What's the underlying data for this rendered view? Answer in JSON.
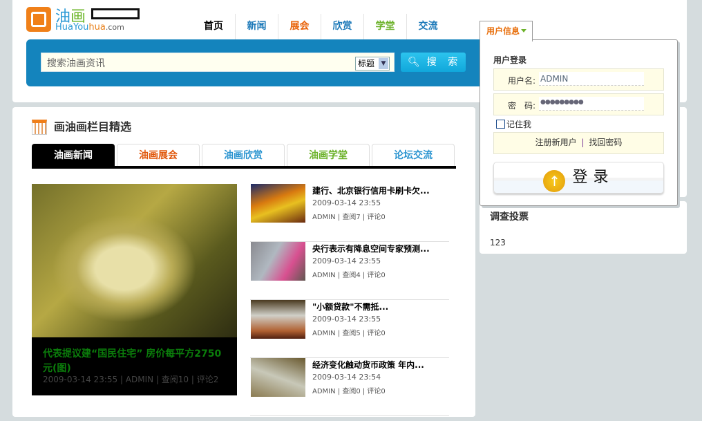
{
  "logo": {
    "cn1": "油",
    "cn2": "画",
    "en1": "HuaYou",
    "en2": "hua",
    "en3": ".com"
  },
  "nav": [
    {
      "label": "首页",
      "color": "#000000"
    },
    {
      "label": "新闻",
      "color": "#1a78b8"
    },
    {
      "label": "展会",
      "color": "#e8640c"
    },
    {
      "label": "欣赏",
      "color": "#1a78b8"
    },
    {
      "label": "学堂",
      "color": "#6cb22a"
    },
    {
      "label": "交流",
      "color": "#1a78b8"
    }
  ],
  "search": {
    "placeholder": "搜索油画资讯",
    "select_value": "标题",
    "button": "搜 索"
  },
  "section": {
    "title": "画油画栏目精选"
  },
  "tabs": [
    {
      "label": "油画新闻",
      "color": "#ffffff"
    },
    {
      "label": "油画展会",
      "color": "#e0560a"
    },
    {
      "label": "油画欣赏",
      "color": "#2a94d0"
    },
    {
      "label": "油画学堂",
      "color": "#6cb22a"
    },
    {
      "label": "论坛交流",
      "color": "#2a94d0"
    }
  ],
  "feature": {
    "title": "代表提议建“国民住宅” 房价每平方2750元(图)",
    "meta": "2009-03-14 23:55 | ADMIN | 查阅10 | 评论2"
  },
  "news": [
    {
      "title": "建行、北京银行信用卡刷卡欠...",
      "date": "2009-03-14 23:55",
      "meta": "ADMIN | 查阅7 | 评论0"
    },
    {
      "title": "央行表示有降息空间专家预测...",
      "date": "2009-03-14 23:55",
      "meta": "ADMIN | 查阅4 | 评论0"
    },
    {
      "title": "\"小额贷款\"不需抵...",
      "date": "2009-03-14 23:55",
      "meta": "ADMIN | 查阅5 | 评论0"
    },
    {
      "title": "经济变化触动货币政策 年内...",
      "date": "2009-03-14 23:54",
      "meta": "ADMIN | 查阅0 | 评论0"
    }
  ],
  "user": {
    "tab": "用户信息",
    "title": "用户登录",
    "username_label": "用户名:",
    "username": "ADMIN",
    "password_label": "密　码:",
    "password": "●●●●●●●●●",
    "remember": "记住我",
    "register": "注册新用户",
    "sep": "|",
    "recover": "找回密码",
    "login": "登录",
    "login_icon": "↑"
  },
  "vote": {
    "title": "调查投票",
    "value": "123"
  }
}
